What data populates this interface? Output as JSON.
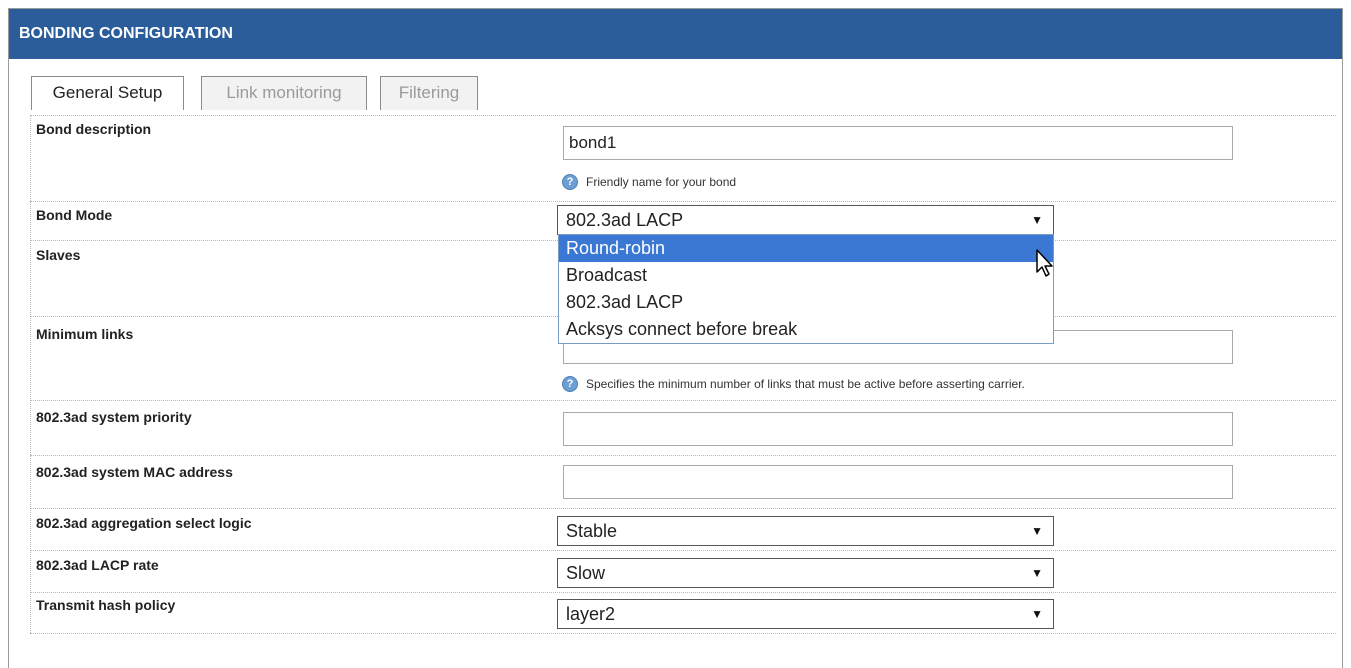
{
  "panel": {
    "title": "BONDING CONFIGURATION"
  },
  "tabs": [
    {
      "label": "General Setup",
      "active": true
    },
    {
      "label": "Link monitoring",
      "active": false
    },
    {
      "label": "Filtering",
      "active": false
    }
  ],
  "fields": {
    "bond_description": {
      "label": "Bond description",
      "value": "bond1",
      "hint": "Friendly name for your bond"
    },
    "bond_mode": {
      "label": "Bond Mode",
      "selected": "802.3ad LACP",
      "options": [
        "Round-robin",
        "Broadcast",
        "802.3ad LACP",
        "Acksys connect before break"
      ],
      "highlighted_option": "Round-robin"
    },
    "slaves": {
      "label": "Slaves"
    },
    "minimum_links": {
      "label": "Minimum links",
      "value": "",
      "hint": "Specifies the minimum number of links that must be active before asserting carrier."
    },
    "system_priority": {
      "label": "802.3ad system priority",
      "value": ""
    },
    "system_mac": {
      "label": "802.3ad system MAC address",
      "value": ""
    },
    "aggregation_logic": {
      "label": "802.3ad aggregation select logic",
      "selected": "Stable"
    },
    "lacp_rate": {
      "label": "802.3ad LACP rate",
      "selected": "Slow"
    },
    "hash_policy": {
      "label": "Transmit hash policy",
      "selected": "layer2"
    }
  },
  "icons": {
    "help": "help-icon",
    "dropdown_arrow": "dropdown-arrow-icon",
    "cursor": "mouse-pointer-icon"
  },
  "colors": {
    "header_bg": "#2a5d9a",
    "highlight": "#3b78d4"
  }
}
